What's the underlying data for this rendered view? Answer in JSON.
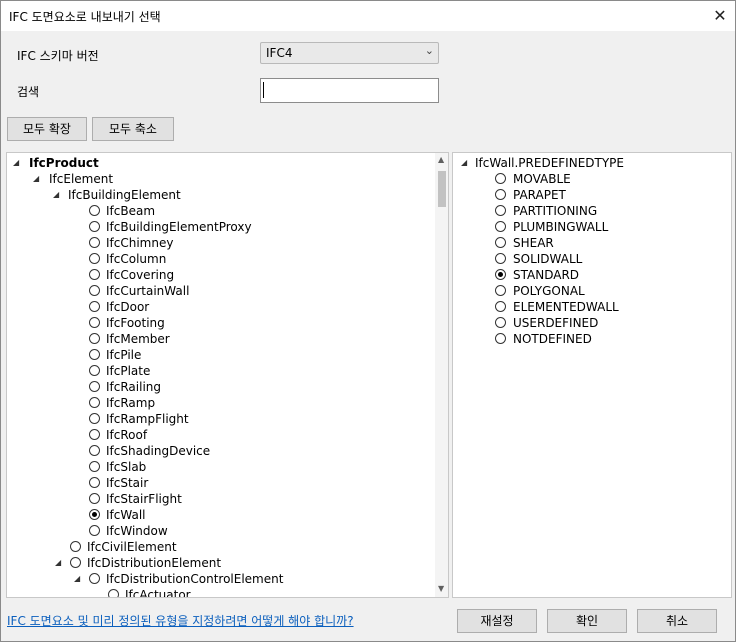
{
  "dialog": {
    "title": "IFC 도면요소로 내보내기 선택"
  },
  "schema": {
    "label": "IFC 스키마 버전",
    "value": "IFC4"
  },
  "search": {
    "label": "검색",
    "value": ""
  },
  "buttons": {
    "expand_all": "모두 확장",
    "collapse_all": "모두 축소"
  },
  "tree": {
    "root": "IfcProduct",
    "element": "IfcElement",
    "building_element": "IfcBuildingElement",
    "building_children": [
      {
        "label": "IfcBeam",
        "selected": false
      },
      {
        "label": "IfcBuildingElementProxy",
        "selected": false
      },
      {
        "label": "IfcChimney",
        "selected": false
      },
      {
        "label": "IfcColumn",
        "selected": false
      },
      {
        "label": "IfcCovering",
        "selected": false
      },
      {
        "label": "IfcCurtainWall",
        "selected": false
      },
      {
        "label": "IfcDoor",
        "selected": false
      },
      {
        "label": "IfcFooting",
        "selected": false
      },
      {
        "label": "IfcMember",
        "selected": false
      },
      {
        "label": "IfcPile",
        "selected": false
      },
      {
        "label": "IfcPlate",
        "selected": false
      },
      {
        "label": "IfcRailing",
        "selected": false
      },
      {
        "label": "IfcRamp",
        "selected": false
      },
      {
        "label": "IfcRampFlight",
        "selected": false
      },
      {
        "label": "IfcRoof",
        "selected": false
      },
      {
        "label": "IfcShadingDevice",
        "selected": false
      },
      {
        "label": "IfcSlab",
        "selected": false
      },
      {
        "label": "IfcStair",
        "selected": false
      },
      {
        "label": "IfcStairFlight",
        "selected": false
      },
      {
        "label": "IfcWall",
        "selected": true
      },
      {
        "label": "IfcWindow",
        "selected": false
      }
    ],
    "civil_element": "IfcCivilElement",
    "distribution_element": "IfcDistributionElement",
    "distribution_control_element": "IfcDistributionControlElement",
    "actuator": "IfcActuator"
  },
  "predefined": {
    "header": "IfcWall.PREDEFINEDTYPE",
    "options": [
      {
        "label": "MOVABLE",
        "selected": false
      },
      {
        "label": "PARAPET",
        "selected": false
      },
      {
        "label": "PARTITIONING",
        "selected": false
      },
      {
        "label": "PLUMBINGWALL",
        "selected": false
      },
      {
        "label": "SHEAR",
        "selected": false
      },
      {
        "label": "SOLIDWALL",
        "selected": false
      },
      {
        "label": "STANDARD",
        "selected": true
      },
      {
        "label": "POLYGONAL",
        "selected": false
      },
      {
        "label": "ELEMENTEDWALL",
        "selected": false
      },
      {
        "label": "USERDEFINED",
        "selected": false
      },
      {
        "label": "NOTDEFINED",
        "selected": false
      }
    ]
  },
  "footer": {
    "help_link": "IFC 도면요소 및 미리 정의된 유형을 지정하려면 어떻게 해야 합니까?",
    "reset": "재설정",
    "ok": "확인",
    "cancel": "취소"
  }
}
